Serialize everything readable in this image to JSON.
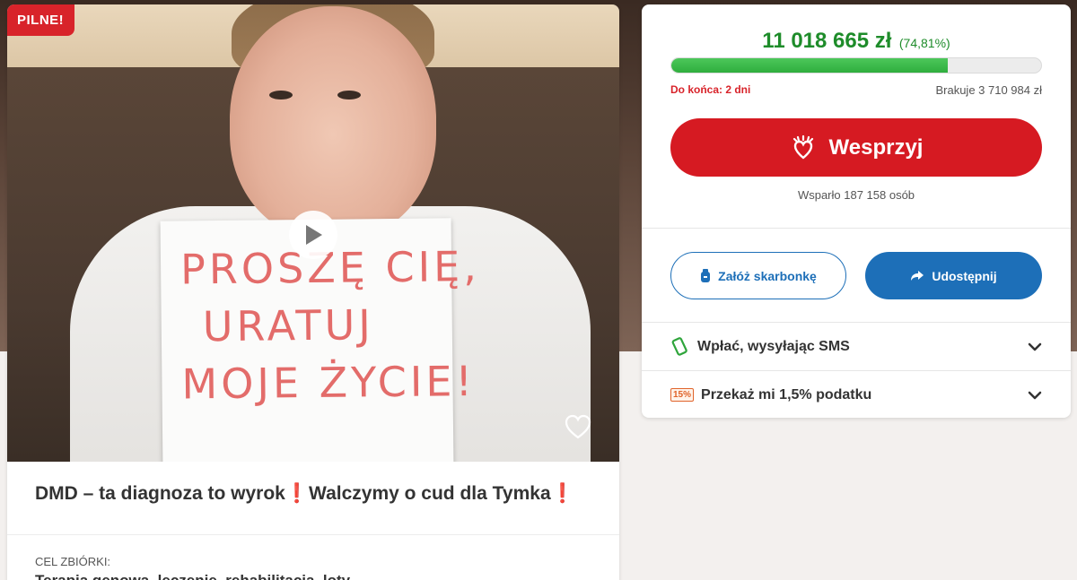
{
  "badge": "PILNE!",
  "sign": {
    "line1": "PROSZĘ CIĘ,",
    "line2": "URATUJ",
    "line3": "MOJE ŻYCIE!"
  },
  "title": {
    "text": "DMD – ta diagnoza to wyrok",
    "text2": "Walczymy o cud dla Tymka",
    "excl": "❗"
  },
  "goal": {
    "label": "CEL ZBIÓRKI:",
    "value": "Terapia genowa, leczenie, rehabilitacja, loty"
  },
  "fundraiser": {
    "amount": "11 018 665 zł",
    "percent_label": "(74,81%)",
    "progress_percent": 74.81,
    "deadline": "Do końca: 2 dni",
    "missing": "Brakuje 3 710 984 zł",
    "support_label": "Wesprzyj",
    "supporters": "Wsparło 187 158 osób",
    "piggybank_label": "Załóż skarbonkę",
    "share_label": "Udostępnij",
    "sms_label": "Wpłać, wysyłając SMS",
    "tax_label": "Przekaż mi 1,5% podatku",
    "tax_icon_text": "15%"
  },
  "colors": {
    "accent_red": "#d61a22",
    "accent_green": "#1e8c2a",
    "accent_blue": "#1d6fb8"
  },
  "icons": {
    "play": "play-icon",
    "heart": "heart-icon",
    "support": "heart-hands-icon",
    "piggybank": "piggybank-icon",
    "share": "share-arrow-icon",
    "sms": "phone-icon",
    "tax": "percent-icon",
    "chevron": "chevron-down-icon"
  }
}
